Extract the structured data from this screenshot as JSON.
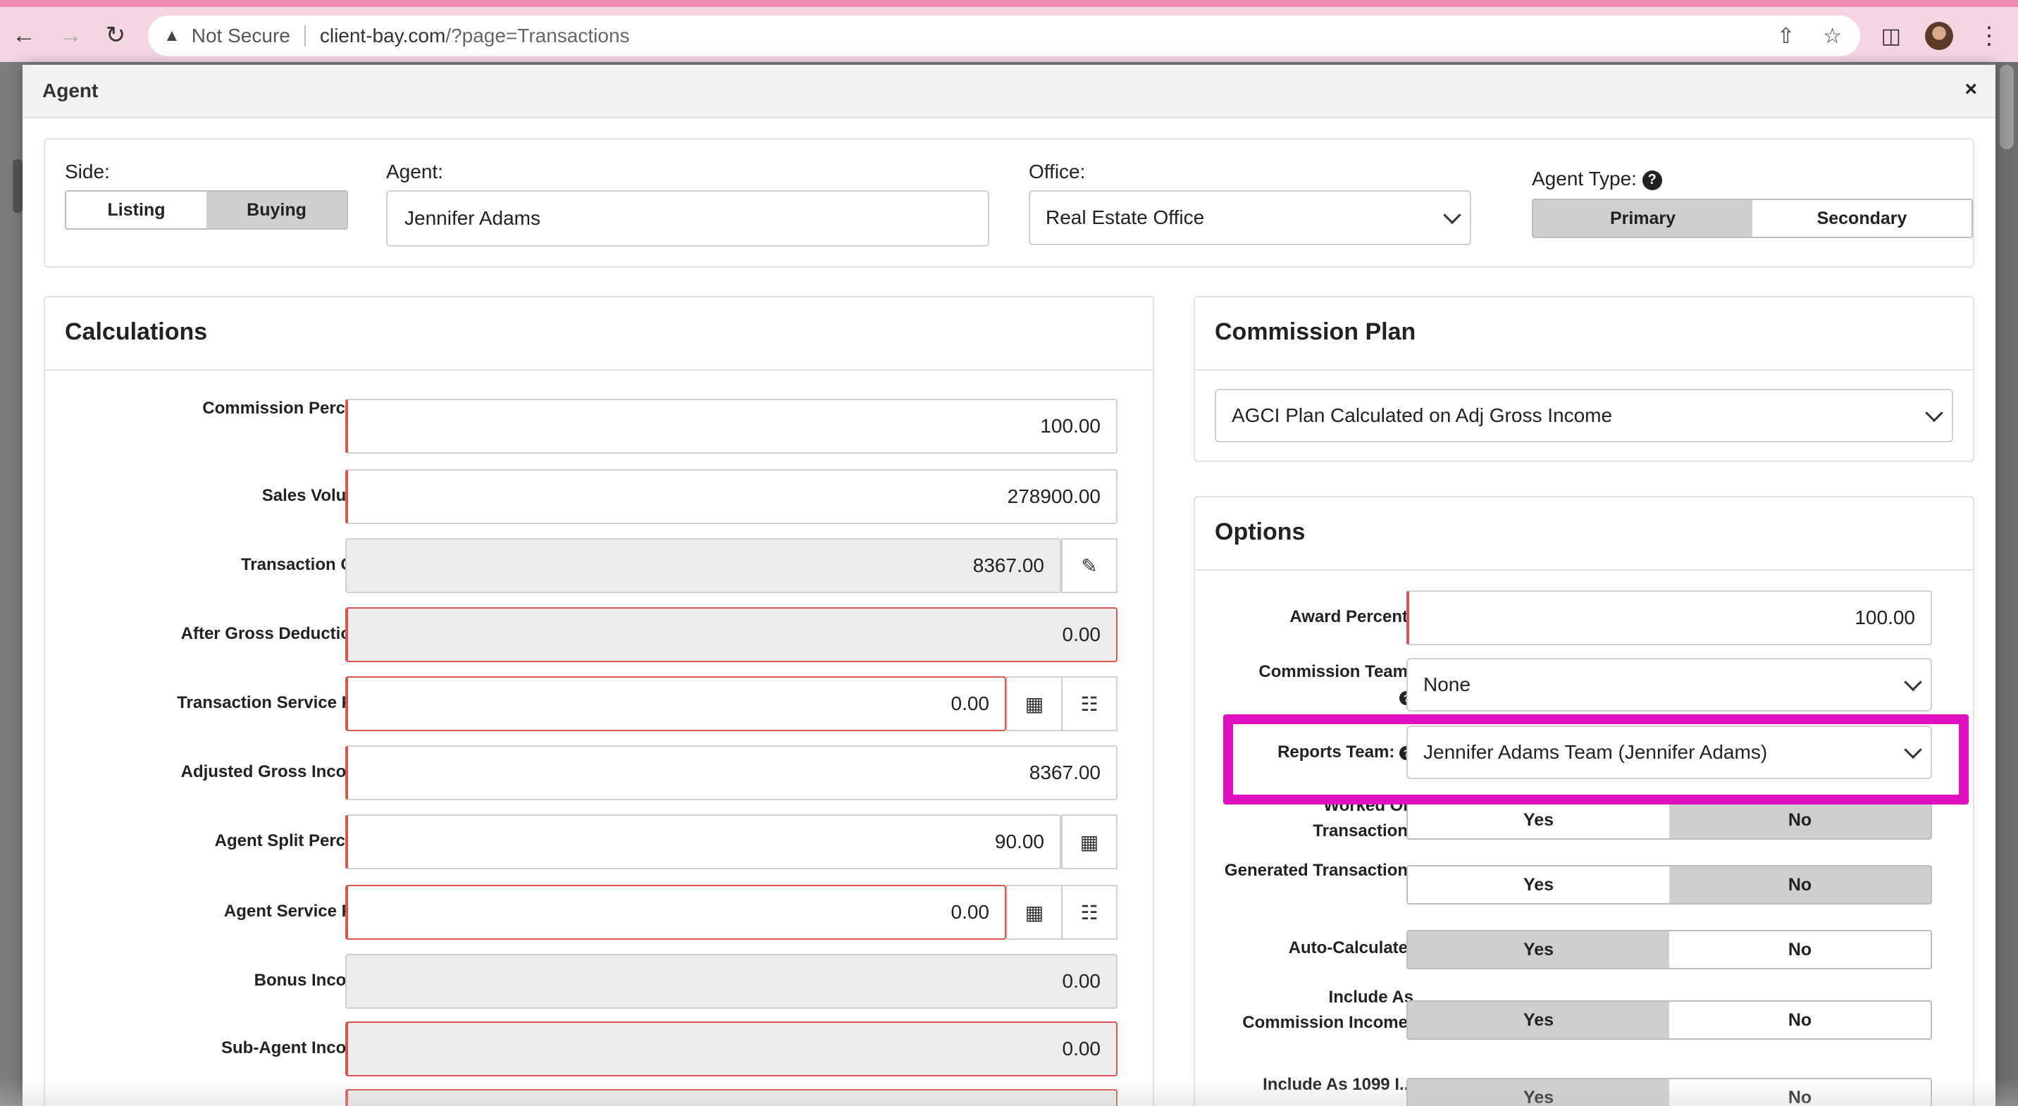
{
  "browser": {
    "security_label": "Not Secure",
    "url_host": "client-bay.com",
    "url_path": "/?page=Transactions"
  },
  "modal": {
    "title": "Agent",
    "close_label": "×"
  },
  "top": {
    "side_label": "Side:",
    "side_options": [
      "Listing",
      "Buying"
    ],
    "side_selected": "Buying",
    "agent_label": "Agent:",
    "agent_value": "Jennifer Adams",
    "office_label": "Office:",
    "office_value": "Real Estate Office",
    "agent_type_label": "Agent Type:",
    "agent_type_options": [
      "Primary",
      "Secondary"
    ],
    "agent_type_selected": "Primary"
  },
  "calculations": {
    "title": "Calculations",
    "rows": [
      {
        "label": "Commission Percent:",
        "value": "100.00"
      },
      {
        "label": "Sales Volume:",
        "value": "278900.00"
      },
      {
        "label": "Transaction GCI:",
        "value": "8367.00"
      },
      {
        "label": "After Gross Deductions:",
        "value": "0.00"
      },
      {
        "label": "Transaction Service Fee:",
        "value": "0.00"
      },
      {
        "label": "Adjusted Gross Income:",
        "value": "8367.00"
      },
      {
        "label": "Agent Split Percent:",
        "value": "90.00"
      },
      {
        "label": "Agent Service Fee:",
        "value": "0.00"
      },
      {
        "label": "Bonus Income:",
        "value": "0.00"
      },
      {
        "label": "Sub-Agent Income:",
        "value": "0.00"
      }
    ]
  },
  "commission_plan": {
    "title": "Commission Plan",
    "value": "AGCI Plan Calculated on Adj Gross Income"
  },
  "options": {
    "title": "Options",
    "award_percent_label": "Award Percent:",
    "award_percent_value": "100.00",
    "commission_team_label": "Commission Team:",
    "commission_team_value": "None",
    "reports_team_label": "Reports Team:",
    "reports_team_value": "Jennifer Adams Team (Jennifer Adams)",
    "yes_label": "Yes",
    "no_label": "No",
    "toggles": [
      {
        "label": "Worked On Transaction:",
        "selected": "No"
      },
      {
        "label": "Generated Transaction:",
        "selected": "No"
      },
      {
        "label": "Auto-Calculate:",
        "selected": "Yes"
      },
      {
        "label": "Include As Commission Income:",
        "selected": "Yes"
      },
      {
        "label": "Include As 1099 I...",
        "selected": "Yes"
      }
    ]
  },
  "colors": {
    "highlight": "#e010c0",
    "required": "#d9534f",
    "selected_segment": "#cfcfcf"
  }
}
